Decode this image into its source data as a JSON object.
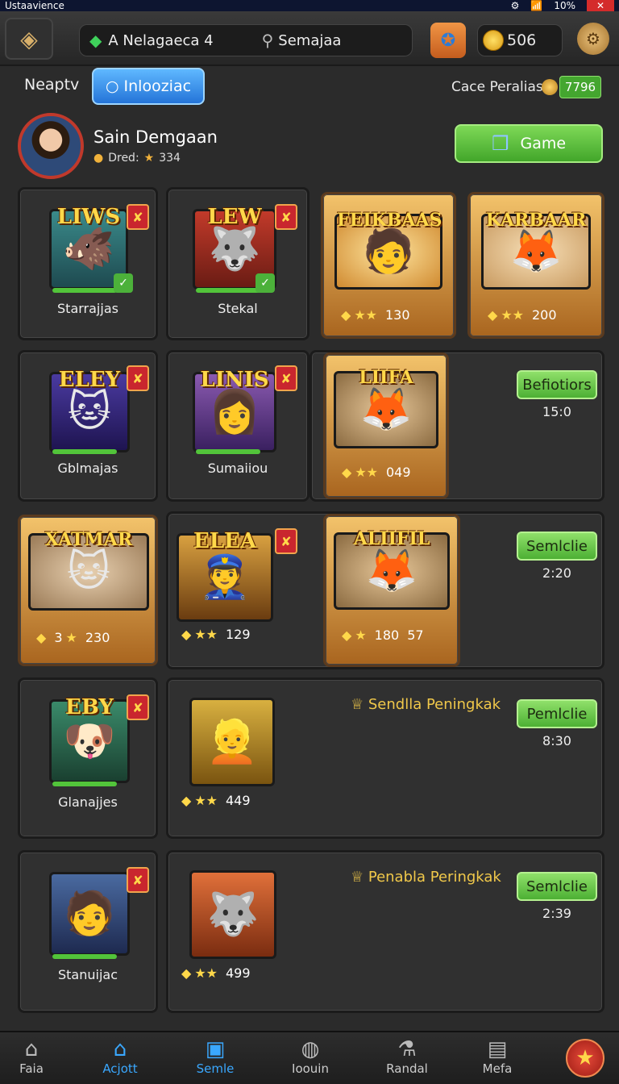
{
  "status": {
    "left": "Ustaavience",
    "battery": "10%"
  },
  "top": {
    "search_label": "A Nelagaeca 4",
    "search_hint": "Semajaa",
    "coins": "506"
  },
  "tabs": {
    "plain": "Neaptv",
    "active": "Inlooziac",
    "currency_label": "Cace Peralias",
    "currency_value": "7796"
  },
  "profile": {
    "name": "Sain Demgaan",
    "sub_label": "Dred:",
    "sub_value": "334",
    "game_button": "Game"
  },
  "rows": [
    {
      "cards": [
        {
          "title": "LIWS",
          "name": "Starrajjas",
          "icon": "creature-boar"
        },
        {
          "title": "LEW",
          "name": "Stekal",
          "icon": "creature-wolf"
        },
        {
          "title": "FEIKBAAS",
          "name": "",
          "icon": "portrait-man",
          "stars_value": "130"
        },
        {
          "title": "KARBAAR",
          "name": "",
          "icon": "creature-fox",
          "stars_value": "200"
        }
      ]
    },
    {
      "cards": [
        {
          "title": "ELEY",
          "name": "Gblmajas",
          "icon": "creature-cat"
        },
        {
          "title": "LINIS",
          "name": "Sumaiiou",
          "icon": "portrait-woman"
        },
        {
          "title": "LIIFA",
          "name": "",
          "icon": "creature-fox",
          "stars_value": "049"
        }
      ],
      "button": "Befiotiors",
      "button_value": "15:0"
    },
    {
      "cards": [
        {
          "title": "XATMAR",
          "name": "",
          "icon": "creature-cat",
          "stars_prefix": "3",
          "stars_value": "230"
        },
        {
          "title": "ELEA",
          "name": "",
          "icon": "portrait-officer",
          "stars_value": "129"
        },
        {
          "title": "ALIIFIL",
          "name": "",
          "icon": "creature-fox",
          "stars_prefix": "180",
          "stars_value": "57"
        }
      ],
      "button": "Semlclie",
      "button_value": "2:20"
    },
    {
      "cards": [
        {
          "title": "EBY",
          "name": "Glanajjes",
          "icon": "creature-dog"
        },
        {
          "title": "",
          "name": "",
          "icon": "portrait-blond",
          "stars_value": "449"
        }
      ],
      "quest": "Sendlla Peningkak",
      "button": "Pemlclie",
      "button_value": "8:30"
    },
    {
      "cards": [
        {
          "title": "",
          "name": "Stanuijac",
          "icon": "portrait-man"
        },
        {
          "title": "",
          "name": "",
          "icon": "creature-wolf",
          "stars_value": "499"
        }
      ],
      "quest": "Penabla Peringkak",
      "button": "Semlclie",
      "button_value": "2:39"
    }
  ],
  "nav": [
    {
      "label": "Faia",
      "icon": "castle-icon"
    },
    {
      "label": "Acjott",
      "icon": "home-icon"
    },
    {
      "label": "Semle",
      "icon": "tv-icon"
    },
    {
      "label": "Ioouin",
      "icon": "bag-icon"
    },
    {
      "label": "Randal",
      "icon": "potion-icon"
    },
    {
      "label": "Mefa",
      "icon": "phone-icon"
    }
  ],
  "colors": {
    "accent_green": "#4db034",
    "accent_blue": "#2474d8",
    "badge_red": "#c9262e",
    "gold": "#ffd84a"
  }
}
